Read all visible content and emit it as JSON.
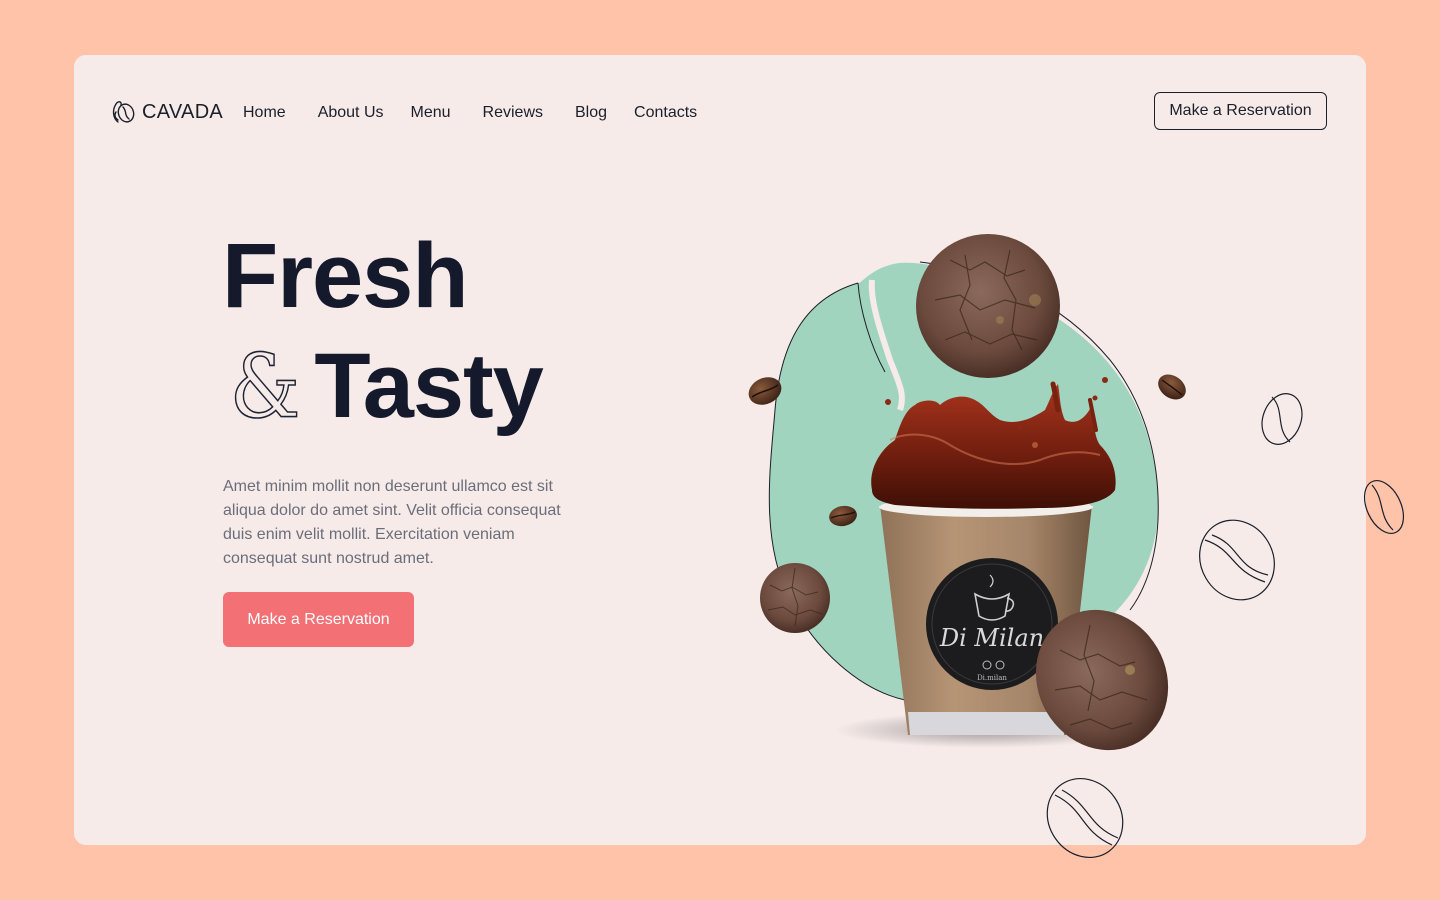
{
  "brand": {
    "name": "CAVADA",
    "icon": "coffee-bean-logo-icon"
  },
  "nav": {
    "items": [
      {
        "label": "Home"
      },
      {
        "label": "About Us"
      },
      {
        "label": "Menu"
      },
      {
        "label": "Reviews"
      },
      {
        "label": "Blog"
      },
      {
        "label": "Contacts"
      }
    ],
    "cta_label": "Make a Reservation"
  },
  "hero": {
    "title_line1": "Fresh",
    "title_amp": "&",
    "title_line2": "Tasty",
    "description": "Amet minim mollit non deserunt ullamco est sit aliqua dolor do amet sint. Velit officia consequat duis enim velit mollit. Exercitation veniam consequat sunt nostrud amet.",
    "cta_label": "Make a Reservation"
  },
  "illustration": {
    "cup_brand": "Di Milan",
    "cup_subtext": "Di.milan",
    "icons": [
      "cookie-icon",
      "coffee-cup-icon",
      "coffee-bean-icon",
      "coffee-splash-icon",
      "bean-outline-icon"
    ]
  },
  "colors": {
    "page_bg": "#FFC3AA",
    "card_bg": "#F6EBE9",
    "accent": "#F37074",
    "blob": "#A0D4BE",
    "text_dark": "#141A2B",
    "text_muted": "#6B6E7A"
  }
}
